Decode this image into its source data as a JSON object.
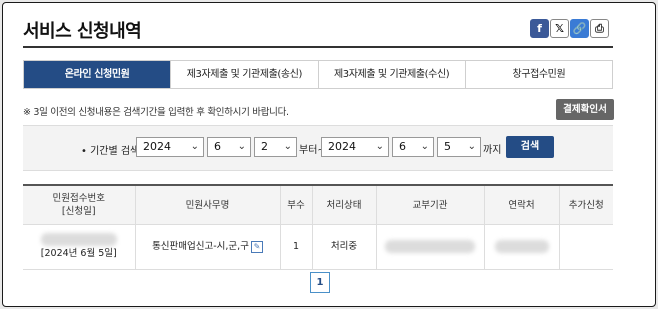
{
  "page_title": "서비스 신청내역",
  "share": {
    "facebook": "f",
    "x": "𝕏",
    "link": "🔗",
    "print": "⎙"
  },
  "tabs": [
    {
      "label": "온라인 신청민원",
      "active": true
    },
    {
      "label": "제3자제출 및 기관제출(송신)",
      "active": false
    },
    {
      "label": "제3자제출 및 기관제출(수신)",
      "active": false
    },
    {
      "label": "창구접수민원",
      "active": false
    }
  ],
  "notice": "※ 3일 이전의 신청내용은 검색기간을 입력한 후 확인하시기 바랍니다.",
  "confirm_button": "결제확인서",
  "filter": {
    "label": "• 기간별 검색",
    "from": {
      "year": "2024",
      "month": "6",
      "day": "2"
    },
    "from_suffix": "부터~",
    "to": {
      "year": "2024",
      "month": "6",
      "day": "5"
    },
    "to_suffix": "까지",
    "search_button": "검색"
  },
  "table": {
    "headers": [
      "민원접수번호\n[신청일]",
      "민원사무명",
      "부수",
      "처리상태",
      "교부기관",
      "연락처",
      "추가신청"
    ],
    "row": {
      "date": "[2024년 6월 5일]",
      "service_name": "통신판매업신고-시,군,구",
      "copies": "1",
      "status": "처리중"
    }
  },
  "pagination": {
    "current": "1"
  }
}
